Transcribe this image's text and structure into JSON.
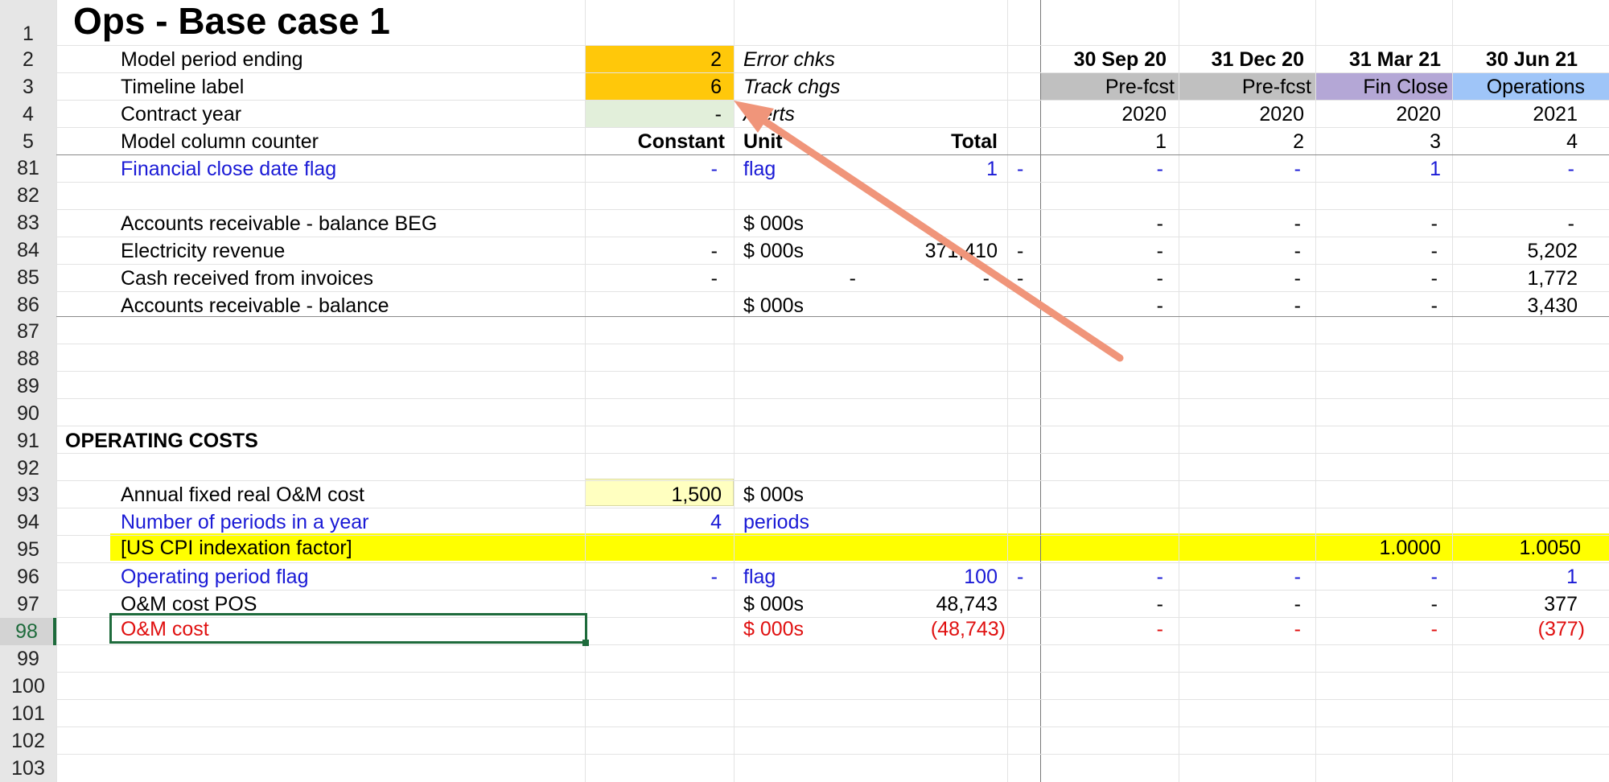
{
  "sheet_title": "Ops - Base case 1",
  "row_numbers": [
    "1",
    "2",
    "3",
    "4",
    "5",
    "81",
    "82",
    "83",
    "84",
    "85",
    "86",
    "87",
    "88",
    "89",
    "90",
    "91",
    "92",
    "93",
    "94",
    "95",
    "96",
    "97",
    "98",
    "99",
    "100",
    "101",
    "102",
    "103"
  ],
  "header": {
    "model_period_ending": {
      "label": "Model period ending",
      "value": "2",
      "note": "Error chks"
    },
    "timeline_label": {
      "label": "Timeline label",
      "value": "6",
      "note": "Track chgs"
    },
    "contract_year": {
      "label": "Contract year",
      "value": "-",
      "note": "Alerts"
    },
    "model_column_counter": {
      "label": "Model column counter",
      "constant": "Constant",
      "unit": "Unit",
      "total": "Total"
    }
  },
  "dates": [
    "30 Sep 20",
    "31 Dec 20",
    "31 Mar 21",
    "30 Jun 21"
  ],
  "phases": [
    {
      "label": "Pre-fcst",
      "color": "#c0c0c0"
    },
    {
      "label": "Pre-fcst",
      "color": "#c0c0c0"
    },
    {
      "label": "Fin Close",
      "color": "#b4a7d6"
    },
    {
      "label": "Operations",
      "color": "#9fc5f8"
    }
  ],
  "years": [
    "2020",
    "2020",
    "2020",
    "2021"
  ],
  "counters": [
    "1",
    "2",
    "3",
    "4"
  ],
  "rows": {
    "fin_close_flag": {
      "label": "Financial close date flag",
      "constant": "-",
      "unit": "flag",
      "total": "1",
      "extra": "-",
      "vals": [
        "-",
        "-",
        "1",
        "-"
      ]
    },
    "ar_beg": {
      "label": "Accounts receivable - balance BEG",
      "unit": "$ 000s",
      "vals": [
        "-",
        "-",
        "-",
        "-"
      ]
    },
    "elec_rev": {
      "label": "Electricity revenue",
      "constant": "-",
      "unit": "$ 000s",
      "total": "371,410",
      "extra": "-",
      "vals": [
        "-",
        "-",
        "-",
        "5,202"
      ]
    },
    "cash_received": {
      "label": "Cash received from invoices",
      "constant": "-",
      "unit_dash": "-",
      "total": "-",
      "extra": "-",
      "vals": [
        "-",
        "-",
        "-",
        "1,772"
      ]
    },
    "ar_balance": {
      "label": "Accounts receivable - balance",
      "unit": "$ 000s",
      "vals": [
        "-",
        "-",
        "-",
        "3,430"
      ]
    },
    "section": {
      "label": "OPERATING COSTS"
    },
    "om_fixed": {
      "label": "Annual fixed real O&M cost",
      "constant": "1,500",
      "unit": "$ 000s"
    },
    "periods_year": {
      "label": "Number of periods in a year",
      "constant": "4",
      "unit": "periods"
    },
    "cpi": {
      "label": "[US CPI indexation factor]",
      "vals": [
        "",
        "",
        "1.0000",
        "1.0050"
      ]
    },
    "op_flag": {
      "label": "Operating period flag",
      "constant": "-",
      "unit": "flag",
      "total": "100",
      "extra": "-",
      "vals": [
        "-",
        "-",
        "-",
        "1"
      ]
    },
    "om_pos": {
      "label": "O&M cost POS",
      "unit": "$ 000s",
      "total": "48,743",
      "vals": [
        "-",
        "-",
        "-",
        "377"
      ]
    },
    "om_cost": {
      "label": "O&M cost",
      "unit": "$ 000s",
      "total": "(48,743)",
      "vals": [
        "-",
        "-",
        "-",
        "(377)"
      ]
    }
  },
  "colors": {
    "orange_input": "#ffc80a",
    "green_input": "#e2efda",
    "yellow_input": "#ffffc0",
    "highlight_yellow": "#ffff00",
    "arrow": "#f0957a",
    "blue_text": "#1a1ad6",
    "red_text": "#e01010"
  }
}
